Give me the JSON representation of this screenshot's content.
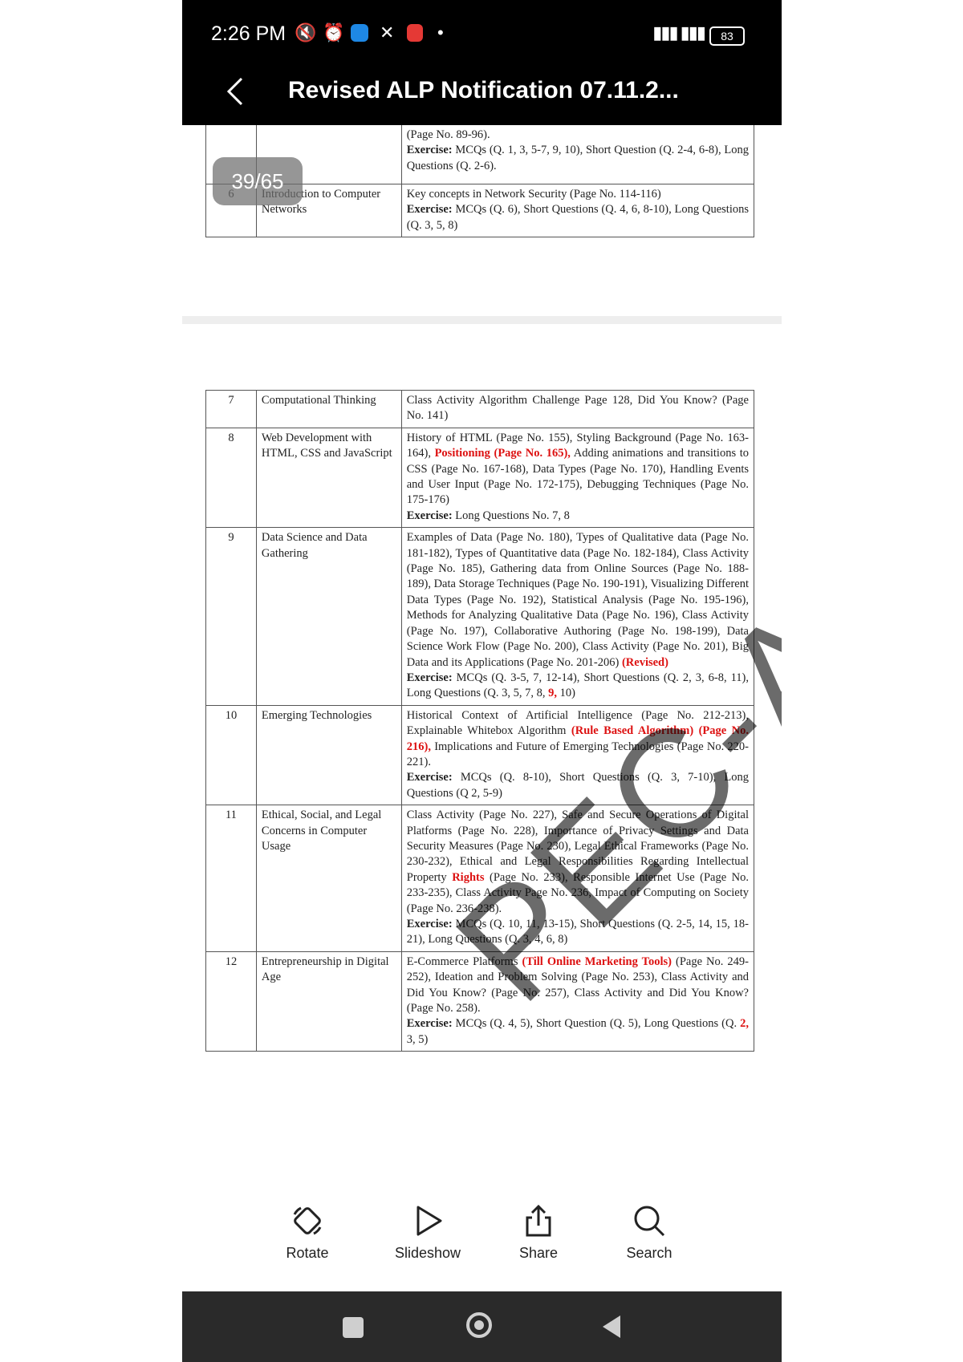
{
  "status_bar": {
    "time": "2:26 PM",
    "battery": "83",
    "icons": [
      "mute-icon",
      "alarm-icon",
      "app-icon",
      "x-icon",
      "app-icon-red",
      "dot-icon"
    ]
  },
  "header": {
    "title": "Revised ALP Notification 07.11.2..."
  },
  "page_indicator": "39/65",
  "watermark": "PEC-AL",
  "table_top": {
    "rows": [
      {
        "num": "",
        "chapter": "",
        "topics": "(Page No. 89-96).",
        "exercise_label": "Exercise:",
        "exercise": " MCQs (Q. 1, 3, 5-7, 9, 10), Short Question (Q. 2-4, 6-8), Long Questions (Q. 2-6)."
      },
      {
        "num": "6",
        "chapter": "Introduction to Computer Networks",
        "topics": "Key concepts in Network Security (Page No. 114-116)",
        "exercise_label": "Exercise:",
        "exercise": " MCQs (Q. 6), Short Questions (Q. 4, 6, 8-10), Long Questions (Q. 3, 5, 8)"
      }
    ]
  },
  "table_main": {
    "row7": {
      "num": "7",
      "chapter": "Computational Thinking",
      "topics": "Class Activity Algorithm Challenge Page 128, Did You Know? (Page No. 141)"
    },
    "row8": {
      "num": "8",
      "chapter": "Web Development with HTML, CSS and JavaScript",
      "topics_a": "History of HTML (Page No. 155), Styling Background (Page No. 163-164), ",
      "topics_red": "Positioning (Page No. 165),",
      "topics_b": " Adding animations and transitions to CSS (Page No. 167-168), Data Types (Page No. 170), Handling Events and User Input (Page No. 172-175), Debugging Techniques (Page No. 175-176)",
      "exercise_label": "Exercise:",
      "exercise": " Long Questions No. 7, 8"
    },
    "row9": {
      "num": "9",
      "chapter": "Data Science and Data Gathering",
      "topics_a": "Examples of Data (Page No. 180), Types of Qualitative data (Page No. 181-182), Types of Quantitative data (Page No. 182-184), Class Activity (Page No. 185), Gathering data from Online Sources (Page No. 188-189), Data Storage Techniques (Page No. 190-191), Visualizing Different Data Types (Page No. 192), Statistical Analysis (Page No. 195-196), Methods for Analyzing Qualitative Data (Page No. 196), Class Activity (Page No. 197), Collaborative Authoring (Page No. 198-199), Data Science Work Flow (Page No. 200), Class Activity (Page No. 201), Big Data and its Applications (Page No. 201-206) ",
      "topics_red": "(Revised)",
      "exercise_label": "Exercise:",
      "exercise_a": " MCQs (Q. 3-5, 7, 12-14), Short Questions (Q. 2, 3, 6-8, 11), Long Questions (Q. 3, 5, 7, 8, ",
      "exercise_red": "9,",
      "exercise_b": " 10)"
    },
    "row10": {
      "num": "10",
      "chapter": "Emerging Technologies",
      "topics_a": "Historical Context of Artificial Intelligence (Page No. 212-213), Explainable Whitebox Algorithm ",
      "topics_red": "(Rule Based Algorithm) (Page No. 216),",
      "topics_b": " Implications and Future of Emerging Technologies (Page No. 220-221).",
      "exercise_label": "Exercise:",
      "exercise": " MCQs (Q. 8-10), Short Questions (Q. 3, 7-10), Long Questions (Q 2, 5-9)"
    },
    "row11": {
      "num": "11",
      "chapter": "Ethical, Social, and Legal Concerns in Computer Usage",
      "topics_a": "Class Activity (Page No. 227), Safe and Secure Operations of Digital Platforms (Page No. 228), Importance of Privacy Settings and Data Security Measures (Page No. 230), Legal Ethical Frameworks (Page No. 230-232), Ethical and Legal Responsibilities Regarding Intellectual Property ",
      "topics_red": "Rights",
      "topics_b": " (Page No. 233), Responsible Internet Use (Page No. 233-235), Class Activity Page No. 236, Impact of Computing on Society (Page No. 236-238).",
      "exercise_label": "Exercise:",
      "exercise": " MCQs (Q. 10, 11, 13-15), Short Questions (Q. 2-5, 14, 15, 18-21), Long Questions (Q. 3, 4, 6, 8)"
    },
    "row12": {
      "num": "12",
      "chapter": "Entrepreneurship in Digital Age",
      "topics_a": "E-Commerce Platforms ",
      "topics_red": "(Till Online Marketing Tools)",
      "topics_b": " (Page No. 249-252), Ideation and Problem Solving (Page No. 253), Class Activity and Did You Know? (Page No. 257), Class Activity and Did You Know? (Page No. 258).",
      "exercise_label": "Exercise:",
      "exercise_a": " MCQs (Q. 4, 5), Short Question (Q. 5), Long Questions (Q. ",
      "exercise_red": "2,",
      "exercise_b": " 3, 5)"
    }
  },
  "toolbar": {
    "rotate": "Rotate",
    "slideshow": "Slideshow",
    "share": "Share",
    "search": "Search"
  }
}
